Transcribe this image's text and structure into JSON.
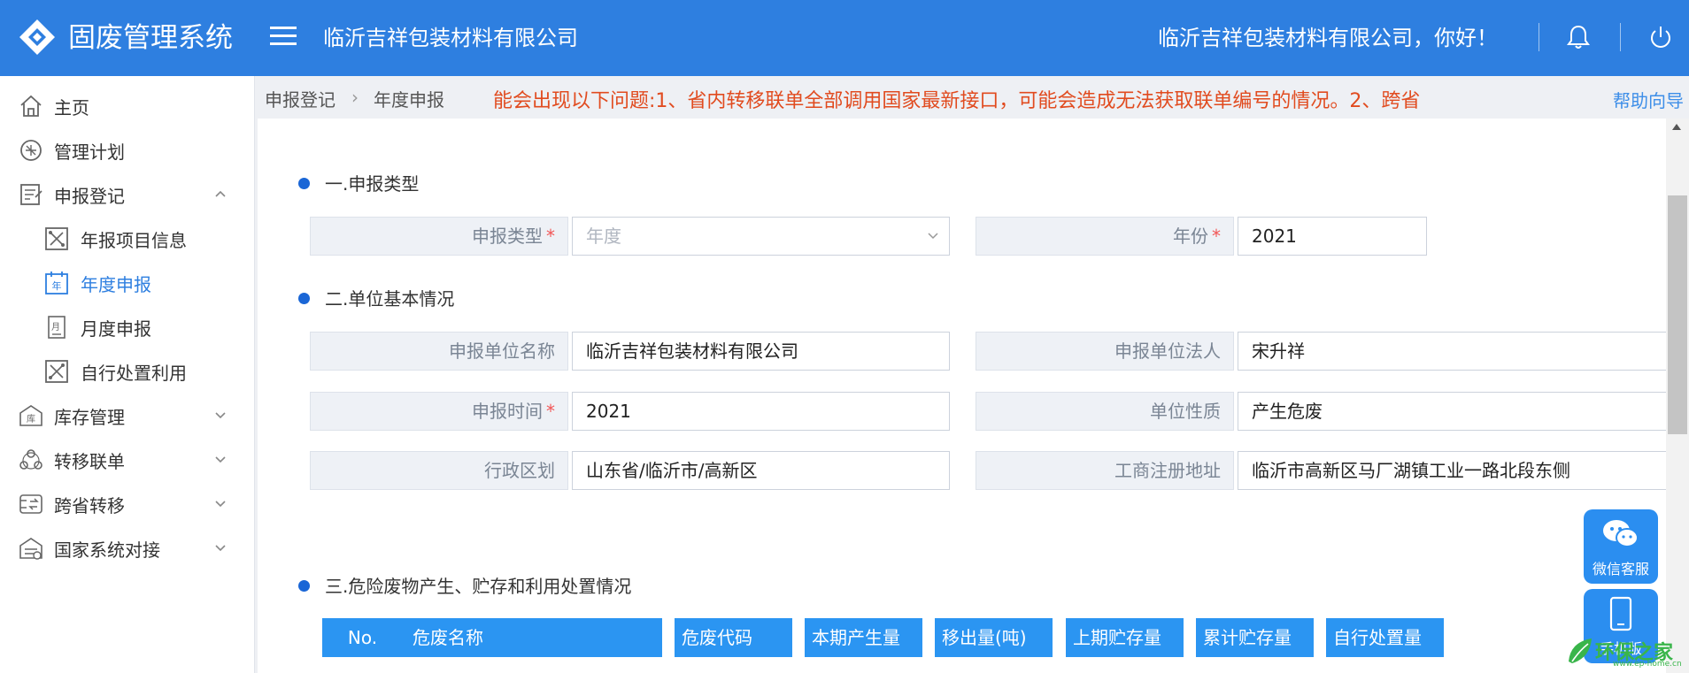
{
  "header": {
    "app_name": "固废管理系统",
    "company": "临沂吉祥包装材料有限公司",
    "greeting": "临沂吉祥包装材料有限公司，你好！",
    "brand_color": "#2e7fe0"
  },
  "sidebar": {
    "items": [
      {
        "label": "主页",
        "icon": "home-icon"
      },
      {
        "label": "管理计划",
        "icon": "plan-icon"
      },
      {
        "label": "申报登记",
        "icon": "register-icon",
        "expanded": true
      },
      {
        "label": "年报项目信息",
        "icon": "project-icon"
      },
      {
        "label": "年度申报",
        "icon": "year-icon",
        "active": true
      },
      {
        "label": "月度申报",
        "icon": "month-icon"
      },
      {
        "label": "自行处置利用",
        "icon": "dispose-icon"
      },
      {
        "label": "库存管理",
        "icon": "warehouse-icon"
      },
      {
        "label": "转移联单",
        "icon": "transfer-icon"
      },
      {
        "label": "跨省转移",
        "icon": "cross-province-icon"
      },
      {
        "label": "国家系统对接",
        "icon": "national-system-icon"
      }
    ]
  },
  "breadcrumb": {
    "items": [
      "申报登记",
      "年度申报"
    ]
  },
  "notice": "能会出现以下问题:1、省内转移联单全部调用国家最新接口，可能会造成无法获取联单编号的情况。2、跨省",
  "help_link": "帮助向导",
  "form": {
    "section1_title": "一.申报类型",
    "section2_title": "二.单位基本情况",
    "section3_title": "三.危险废物产生、贮存和利用处置情况",
    "report_type_label": "申报类型",
    "report_type_value": "年度",
    "year_label": "年份",
    "year_value": "2021",
    "unit_name_label": "申报单位名称",
    "unit_name_value": "临沂吉祥包装材料有限公司",
    "legal_person_label": "申报单位法人",
    "legal_person_value": "宋升祥",
    "report_time_label": "申报时间",
    "report_time_value": "2021",
    "unit_nature_label": "单位性质",
    "unit_nature_value": "产生危废",
    "region_label": "行政区划",
    "region_value": "山东省/临沂市/高新区",
    "address_label": "工商注册地址",
    "address_value": "临沂市高新区马厂湖镇工业一路北段东侧"
  },
  "table": {
    "headers": [
      "No.",
      "危废名称",
      "危废代码",
      "本期产生量",
      "移出量(吨)",
      "上期贮存量",
      "累计贮存量",
      "自行处置量"
    ]
  },
  "float": {
    "wechat_label": "微信客服",
    "mobile_label": "手机版"
  },
  "watermark": {
    "text": "环保之家",
    "sub": "www.ep-home.cn"
  }
}
